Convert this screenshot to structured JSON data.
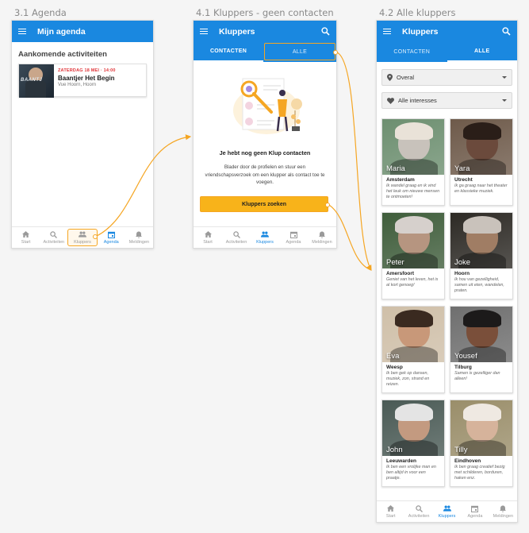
{
  "screens": {
    "agenda": {
      "section_title": "3.1 Agenda",
      "appbar_title": "Mijn agenda",
      "heading": "Aankomende activiteiten",
      "event": {
        "date": "ZATERDAG 18 MEI · 14:00",
        "title": "Baantjer Het Begin",
        "location": "Vue Hoorn, Hoorn",
        "poster_text": "BAANTJ"
      }
    },
    "kluppers_empty": {
      "section_title": "4.1 Kluppers - geen contacten",
      "appbar_title": "Kluppers",
      "tabs": [
        "CONTACTEN",
        "ALLE"
      ],
      "empty_title": "Je hebt nog geen Klup contacten",
      "empty_body": "Blader door de profielen en stuur een vriendschapsverzoek om een klupper als contact toe te voegen.",
      "cta": "Kluppers zoeken"
    },
    "kluppers_all": {
      "section_title": "4.2 Alle kluppers",
      "appbar_title": "Kluppers",
      "tabs": [
        "CONTACTEN",
        "ALLE"
      ],
      "filter_region": "Overal",
      "filter_interest": "Alle interesses",
      "people": [
        {
          "name": "Maria",
          "city": "Amsterdam",
          "quote": "Ik wandel graag en ik vind het leuk om nieuwe mensen te ontmoeten!"
        },
        {
          "name": "Yara",
          "city": "Utrecht",
          "quote": "Ik ga graag naar het theater en klassieke muziek."
        },
        {
          "name": "Peter",
          "city": "Amersfoort",
          "quote": "Geniet van het leven, het is al kort genoeg!"
        },
        {
          "name": "Joke",
          "city": "Hoorn",
          "quote": "Ik hou van gezelligheid, samen uit eten, wandelen, praten."
        },
        {
          "name": "Eva",
          "city": "Weesp",
          "quote": "Ik ben gek op dansen, muziek, zon, strand en reizen."
        },
        {
          "name": "Yousef",
          "city": "Tilburg",
          "quote": "Samen is gezelliger dan alleen!"
        },
        {
          "name": "John",
          "city": "Leeuwarden",
          "quote": "Ik ben een vrolijke man en ben altijd in voor een praatje."
        },
        {
          "name": "Tilly",
          "city": "Eindhoven",
          "quote": "Ik ben graag creatief bezig met schilderen, borduren, haken enz."
        }
      ]
    }
  },
  "bottom_nav": [
    "Start",
    "Activiteiten",
    "Kluppers",
    "Agenda",
    "Meldingen"
  ],
  "colors": {
    "primary": "#1a88e0",
    "accent": "#f5a623",
    "date_red": "#e0363a"
  }
}
